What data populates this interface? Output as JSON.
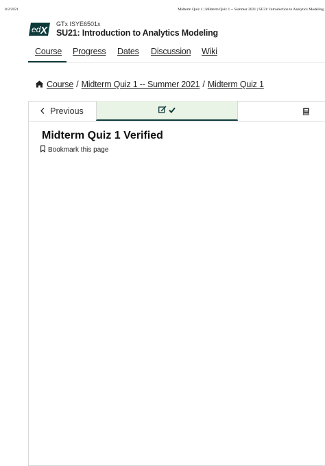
{
  "print_header": {
    "date": "8/2/2021",
    "title": "Midterm Quiz 1 | Midterm Quiz 1 -- Summer 2021 | SU21: Introduction to Analytics Modeling"
  },
  "brand": {
    "logo_text": "edX",
    "logo_color": "#0f3a3a"
  },
  "course": {
    "org_code": "GTx ISYE6501x",
    "title": "SU21: Introduction to Analytics Modeling"
  },
  "nav": {
    "tabs": [
      {
        "label": "Course",
        "active": true
      },
      {
        "label": "Progress"
      },
      {
        "label": "Dates"
      },
      {
        "label": "Discussion"
      },
      {
        "label": "Wiki"
      }
    ]
  },
  "breadcrumb": {
    "home_icon": "home-icon",
    "items": [
      {
        "label": "Course"
      },
      {
        "label": "Midterm Quiz 1 -- Summer 2021"
      },
      {
        "label": "Midterm Quiz 1"
      }
    ],
    "separator": "/"
  },
  "sequence": {
    "previous_label": "Previous",
    "active_unit_icons": [
      "edit-icon",
      "check-icon"
    ],
    "next_unit_icon": "book-icon",
    "active_color": "#e9f3e6"
  },
  "unit": {
    "title": "Midterm Quiz 1 Verified",
    "bookmark_label": "Bookmark this page"
  }
}
